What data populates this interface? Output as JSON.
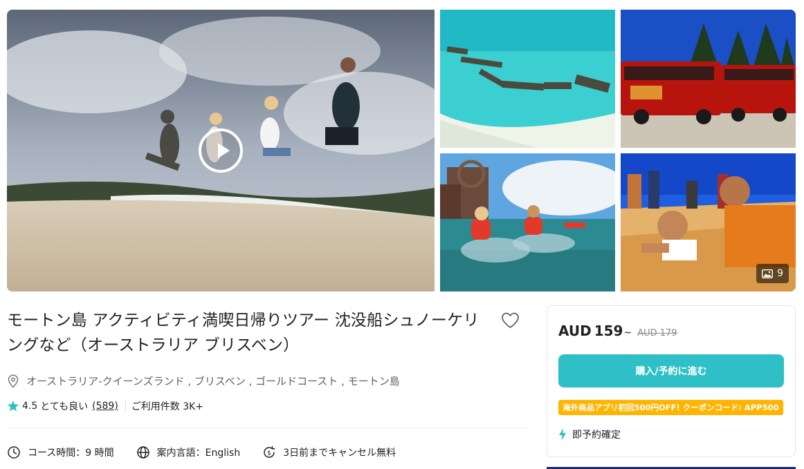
{
  "gallery": {
    "photo_count": "9",
    "images": [
      "dune-jump-photo",
      "shipwreck-aerial-photo",
      "safari-bus-photo",
      "kayak-photo",
      "sandboarding-photo"
    ]
  },
  "product": {
    "title": "モートン島 アクティビティ満喫日帰りツアー 沈没船シュノーケリングなど（オーストラリア ブリスベン）",
    "location": "オーストラリア-クイーンズランド , ブリスベン , ゴールドコースト , モートン島",
    "rating": {
      "score": "4.5",
      "label": "とても良い",
      "count": "(589)"
    },
    "booked": "ご利用件数 3K+",
    "info": {
      "duration": "コース時間：9 時間",
      "language": "案内言語：English",
      "cancel": "3日前までキャンセル無料"
    }
  },
  "booking": {
    "currency": "AUD",
    "price": "159",
    "tilde": "~",
    "old_price": "AUD 179",
    "buy_label": "購入/予約に進む",
    "promo": "海外商品アプリ初回500円OFF! クーポンコード: APP500",
    "instant_label": "即予約確定"
  },
  "colors": {
    "accent": "#2fbfc7",
    "promo": "#ffb400",
    "star": "#2fbfc7"
  }
}
